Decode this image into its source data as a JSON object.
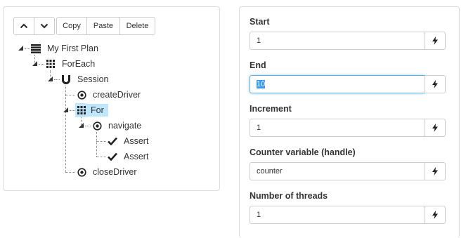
{
  "toolbar": {
    "move_up_icon": "chevron-up-icon",
    "move_down_icon": "chevron-down-icon",
    "copy_label": "Copy",
    "paste_label": "Paste",
    "delete_label": "Delete"
  },
  "tree": {
    "root": {
      "label": "My First Plan",
      "icon": "list-icon"
    },
    "foreach": {
      "label": "ForEach",
      "icon": "grid-icon"
    },
    "session": {
      "label": "Session",
      "icon": "magnet-icon"
    },
    "create_driver": {
      "label": "createDriver",
      "icon": "target-icon"
    },
    "for": {
      "label": "For",
      "icon": "grid-icon",
      "selected": true
    },
    "navigate": {
      "label": "navigate",
      "icon": "target-icon"
    },
    "assert1": {
      "label": "Assert",
      "icon": "check-icon"
    },
    "assert2": {
      "label": "Assert",
      "icon": "check-icon"
    },
    "close_driver": {
      "label": "closeDriver",
      "icon": "target-icon"
    }
  },
  "form": {
    "start": {
      "label": "Start",
      "value": "1"
    },
    "end": {
      "label": "End",
      "value": "10"
    },
    "increment": {
      "label": "Increment",
      "value": "1"
    },
    "counter": {
      "label": "Counter variable (handle)",
      "value": "counter"
    },
    "threads": {
      "label": "Number of threads",
      "value": "1"
    },
    "dynamic_icon": "lightning-bolt-icon"
  },
  "colors": {
    "selection": "#bee6fd",
    "focus_border": "#66afe9",
    "text_selection": "#3399ff"
  }
}
